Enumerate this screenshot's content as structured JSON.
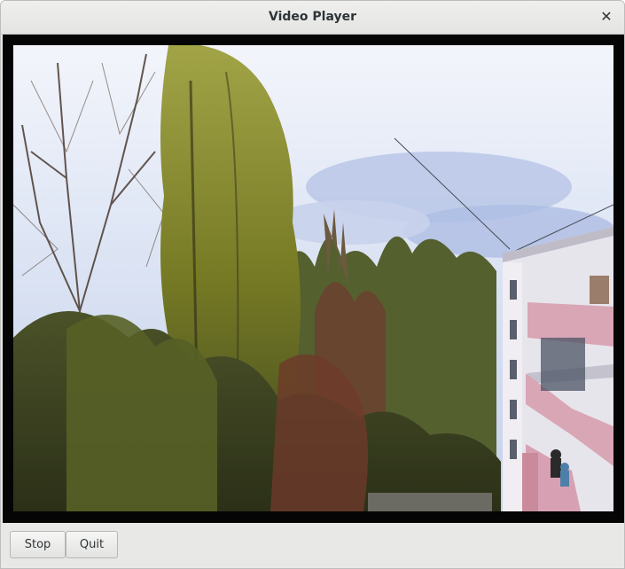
{
  "window": {
    "title": "Video Player"
  },
  "video": {
    "description_icon": "video-frame",
    "colors": {
      "sky": "#dfe7f4",
      "cloud": "#b9c6e6",
      "foliage_yellow": "#8b8f2a",
      "foliage_dark": "#3b4522",
      "building": "#e9e6ee",
      "balcony": "#d7a3b3"
    }
  },
  "controls": {
    "stop_label": "Stop",
    "quit_label": "Quit"
  }
}
